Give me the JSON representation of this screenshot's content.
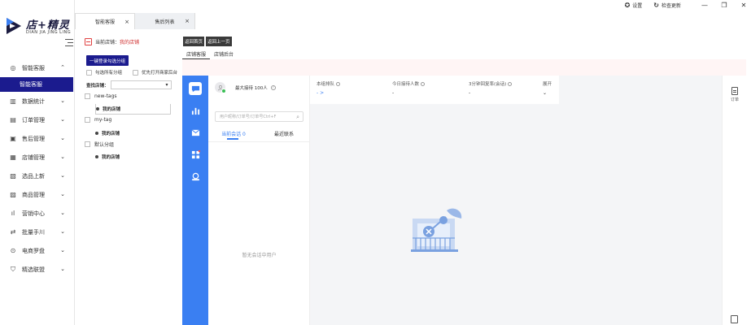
{
  "app": {
    "logo_title": "店+精灵",
    "logo_subtitle": "DIAN JIA JING LING"
  },
  "top_actions": {
    "settings": "设置",
    "check_update": "检查更新"
  },
  "tabs": [
    {
      "label": "智能客服",
      "active": true
    },
    {
      "label": "售后列表",
      "active": false
    }
  ],
  "sidebar": {
    "items": [
      {
        "label": "智能客服",
        "icon": "headset-icon",
        "expanded": true
      },
      {
        "label": "数据统计",
        "icon": "chart-icon"
      },
      {
        "label": "订单管理",
        "icon": "order-icon"
      },
      {
        "label": "售后管理",
        "icon": "aftersale-icon"
      },
      {
        "label": "店铺管理",
        "icon": "store-icon"
      },
      {
        "label": "选品上新",
        "icon": "product-select-icon"
      },
      {
        "label": "商品管理",
        "icon": "goods-icon"
      },
      {
        "label": "营销中心",
        "icon": "marketing-icon"
      },
      {
        "label": "批量手川",
        "icon": "batch-icon"
      },
      {
        "label": "电商罗盘",
        "icon": "compass-icon"
      },
      {
        "label": "精选联盟",
        "icon": "alliance-icon"
      }
    ],
    "active_sub": "智能客服"
  },
  "store_panel": {
    "current_store_label": "当前店铺：",
    "current_store_value": "我的店铺",
    "login_button": "一键登录勾选分组",
    "check_all": "勾选所有分组",
    "priority_open": "优先打开商家后台",
    "search_label": "查找店铺：",
    "groups": [
      {
        "name": "new-tags",
        "stores": [
          "我的店铺"
        ]
      },
      {
        "name": "my-tag",
        "stores": [
          "我的店铺"
        ]
      },
      {
        "name": "默认分组",
        "stores": [
          "我的店铺"
        ]
      }
    ]
  },
  "main": {
    "back_home": "返回首页",
    "back_prev": "返回上一页",
    "sub_tabs": [
      {
        "label": "店铺客服",
        "active": true
      },
      {
        "label": "店铺后台",
        "active": false
      }
    ]
  },
  "chat": {
    "max_receive": "最大接待 100人",
    "search_placeholder": "用户昵称/订单号/订单号Ctrl+F",
    "convo_tabs": [
      {
        "label": "当前会话 0",
        "active": true
      },
      {
        "label": "最近联系",
        "active": false
      }
    ],
    "empty_text": "暂无会话中用户",
    "stats": [
      {
        "label": "本组排队",
        "value": "- >"
      },
      {
        "label": "今日接待人数",
        "value": "-"
      },
      {
        "label": "3分钟回复率(会话)",
        "value": "-"
      },
      {
        "label": "展开",
        "value": "⌄"
      }
    ],
    "right_rail_label": "订单"
  },
  "colors": {
    "primary": "#1b1b8e",
    "rail_blue": "#3a7ff2",
    "online": "#3bbf55",
    "accent_red": "#d03030"
  }
}
